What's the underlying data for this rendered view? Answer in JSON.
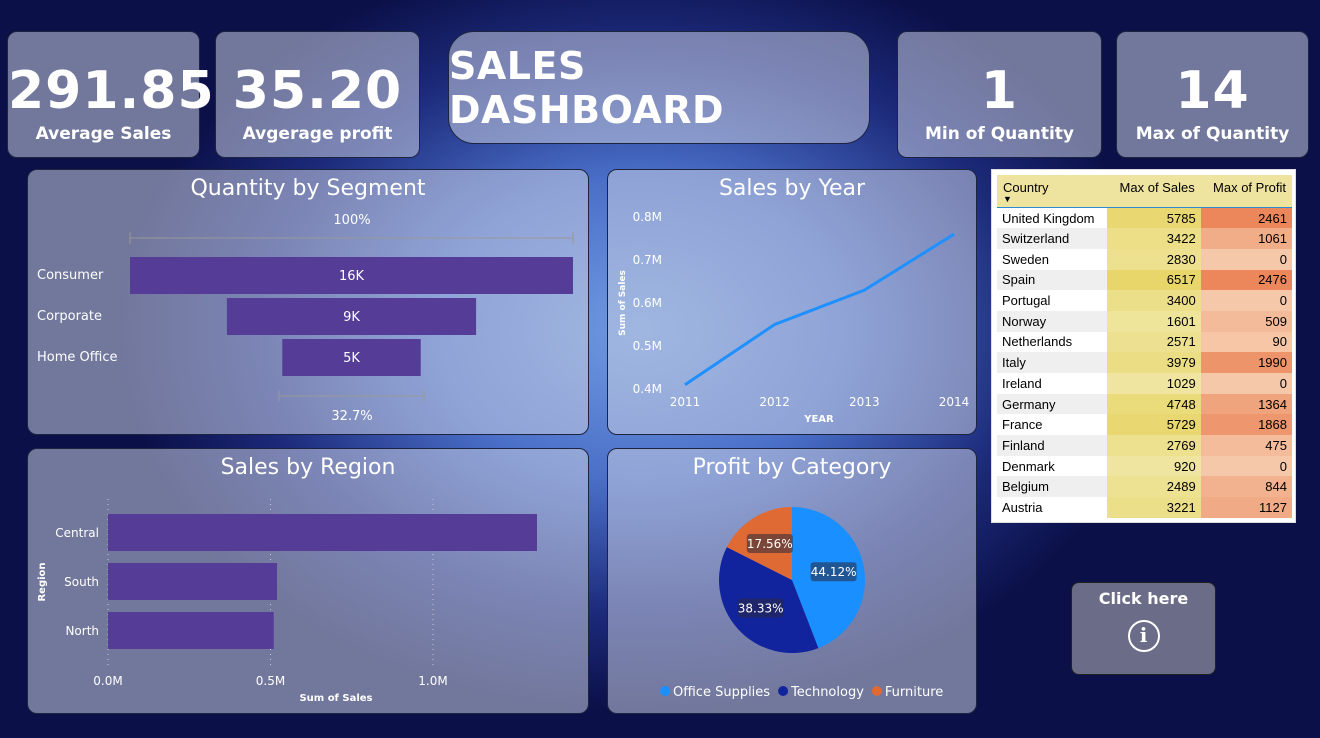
{
  "kpis": {
    "avg_sales": {
      "value": "291.85",
      "label": "Average Sales"
    },
    "avg_profit": {
      "value": "35.20",
      "label": "Avgerage profit"
    },
    "min_qty": {
      "value": "1",
      "label": "Min of Quantity"
    },
    "max_qty": {
      "value": "14",
      "label": "Max of Quantity"
    }
  },
  "dashboard_title": "SALES DASHBOARD",
  "segment": {
    "title": "Quantity by Segment",
    "top_pct": "100%",
    "bottom_pct": "32.7%",
    "items": [
      {
        "name": "Consumer",
        "label": "16K"
      },
      {
        "name": "Corporate",
        "label": "9K"
      },
      {
        "name": "Home Office",
        "label": "5K"
      }
    ]
  },
  "sales_by_year": {
    "title": "Sales by Year",
    "ylabel": "Sum of Sales",
    "xlabel": "YEAR"
  },
  "sales_by_region": {
    "title": "Sales by Region",
    "ylabel": "Region",
    "xlabel": "Sum of Sales"
  },
  "profit_by_category": {
    "title": "Profit by Category"
  },
  "chart_data": [
    {
      "type": "bar",
      "title": "Quantity by Segment",
      "categories": [
        "Consumer",
        "Corporate",
        "Home Office"
      ],
      "values": [
        16000,
        9000,
        5000
      ],
      "data_labels": [
        "16K",
        "9K",
        "5K"
      ],
      "funnel": true
    },
    {
      "type": "line",
      "title": "Sales by Year",
      "x": [
        "2011",
        "2012",
        "2013",
        "2014"
      ],
      "values": [
        0.41,
        0.55,
        0.63,
        0.76
      ],
      "xlabel": "YEAR",
      "ylabel": "Sum of Sales",
      "ylim": [
        0.4,
        0.8
      ],
      "yticks": [
        "0.4M",
        "0.5M",
        "0.6M",
        "0.7M",
        "0.8M"
      ],
      "color": "#1e90ff"
    },
    {
      "type": "bar",
      "orientation": "horizontal",
      "title": "Sales by Region",
      "categories": [
        "Central",
        "South",
        "North"
      ],
      "values": [
        1.32,
        0.52,
        0.51
      ],
      "xlabel": "Sum of Sales",
      "ylabel": "Region",
      "xlim": [
        0,
        1.5
      ],
      "xticks": [
        "0.0M",
        "0.5M",
        "1.0M"
      ],
      "color": "#553c97"
    },
    {
      "type": "pie",
      "title": "Profit by Category",
      "categories": [
        "Office Supplies",
        "Technology",
        "Furniture"
      ],
      "values": [
        44.12,
        38.33,
        17.56
      ],
      "labels": [
        "44.12%",
        "38.33%",
        "17.56%"
      ],
      "colors": [
        "#1a8fff",
        "#12239e",
        "#e06a34"
      ],
      "legend": "bottom"
    }
  ],
  "table": {
    "headers": [
      "Country",
      "Max of Sales",
      "Max of Profit"
    ],
    "rows": [
      [
        "United Kingdom",
        "5785",
        "2461"
      ],
      [
        "Switzerland",
        "3422",
        "1061"
      ],
      [
        "Sweden",
        "2830",
        "0"
      ],
      [
        "Spain",
        "6517",
        "2476"
      ],
      [
        "Portugal",
        "3400",
        "0"
      ],
      [
        "Norway",
        "1601",
        "509"
      ],
      [
        "Netherlands",
        "2571",
        "90"
      ],
      [
        "Italy",
        "3979",
        "1990"
      ],
      [
        "Ireland",
        "1029",
        "0"
      ],
      [
        "Germany",
        "4748",
        "1364"
      ],
      [
        "France",
        "5729",
        "1868"
      ],
      [
        "Finland",
        "2769",
        "475"
      ],
      [
        "Denmark",
        "920",
        "0"
      ],
      [
        "Belgium",
        "2489",
        "844"
      ],
      [
        "Austria",
        "3221",
        "1127"
      ]
    ]
  },
  "info_button": {
    "label": "Click here",
    "icon": "info-icon"
  }
}
